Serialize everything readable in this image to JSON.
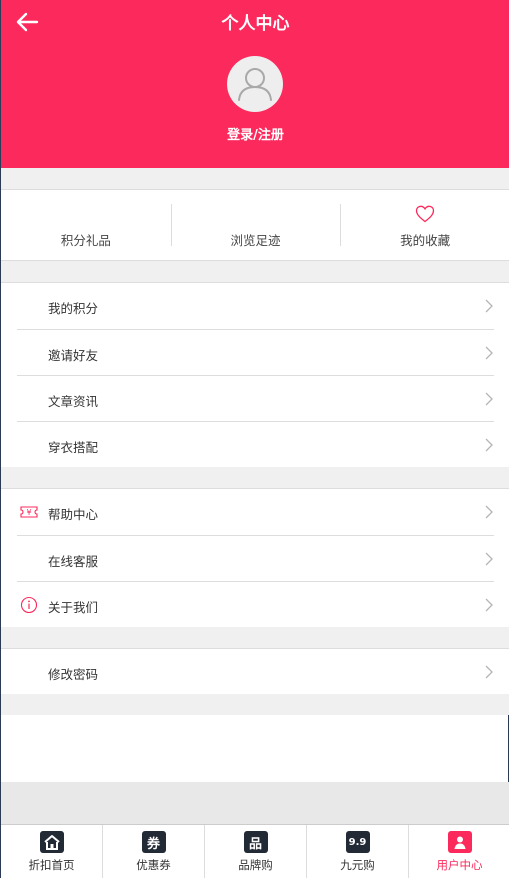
{
  "header": {
    "title": "个人中心",
    "login_label": "登录/注册"
  },
  "quick_links": [
    {
      "label": "积分礼品"
    },
    {
      "label": "浏览足迹"
    },
    {
      "label": "我的收藏",
      "icon": "heart-outline-icon"
    }
  ],
  "groups": [
    {
      "items": [
        {
          "label": "我的积分"
        },
        {
          "label": "邀请好友"
        },
        {
          "label": "文章资讯"
        },
        {
          "label": "穿衣搭配"
        }
      ]
    },
    {
      "items": [
        {
          "label": "帮助中心",
          "icon": "ticket-yen-icon"
        },
        {
          "label": "在线客服"
        },
        {
          "label": "关于我们",
          "icon": "info-circle-icon"
        }
      ]
    },
    {
      "items": [
        {
          "label": "修改密码"
        }
      ]
    }
  ],
  "bottom_nav": [
    {
      "label": "折扣首页",
      "icon": "home-icon"
    },
    {
      "label": "优惠券",
      "icon": "coupon-icon",
      "glyph": "券"
    },
    {
      "label": "品牌购",
      "icon": "brand-icon",
      "glyph": "品"
    },
    {
      "label": "九元购",
      "icon": "nine-nine-icon",
      "glyph": "9.9"
    },
    {
      "label": "用户中心",
      "icon": "user-center-icon",
      "active": true
    }
  ],
  "colors": {
    "accent": "#fc2a5c",
    "background_gap": "#f0f0f0",
    "divider": "#dddddd",
    "nav_icon": "#222a36"
  }
}
